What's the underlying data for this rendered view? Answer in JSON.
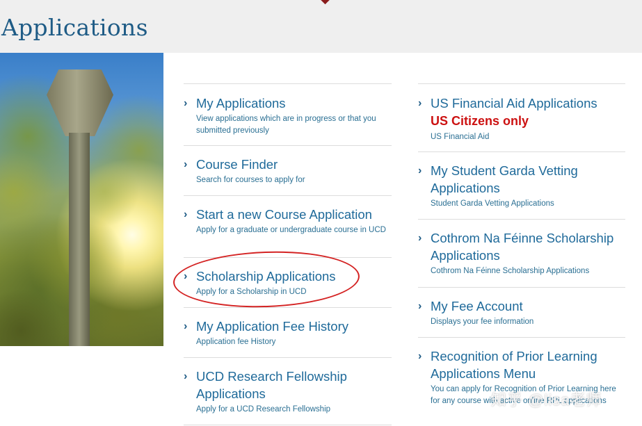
{
  "page": {
    "title": "Applications"
  },
  "left_column": [
    {
      "title": "My Applications",
      "desc": "View applications which are in progress or that you submitted previously"
    },
    {
      "title": "Course Finder",
      "desc": "Search for courses to apply for"
    },
    {
      "title": "Start a new Course Application",
      "desc": "Apply for a graduate or undergraduate course in UCD"
    },
    {
      "title": "Scholarship Applications",
      "desc": "Apply for a Scholarship in UCD"
    },
    {
      "title": "My Application Fee History",
      "desc": "Application fee History"
    },
    {
      "title": "UCD Research Fellowship Applications",
      "desc": "Apply for a UCD Research Fellowship"
    }
  ],
  "right_column": [
    {
      "title": "US Financial Aid Applications",
      "note": "US Citizens only",
      "desc": "US Financial Aid"
    },
    {
      "title": "My Student Garda Vetting Applications",
      "desc": "Student Garda Vetting Applications"
    },
    {
      "title": "Cothrom Na Féinne Scholarship Applications",
      "desc": "Cothrom Na Féinne Scholarship Applications"
    },
    {
      "title": "My Fee Account",
      "desc": "Displays your fee information"
    },
    {
      "title": "Recognition of Prior Learning Applications Menu",
      "desc": "You can apply for Recognition of Prior Learning here for any course with active online RPL applications"
    }
  ],
  "watermark": {
    "text": "知乎 @lisa老师"
  },
  "colors": {
    "link": "#1f6a9a",
    "warning": "#cc1111",
    "annotation": "#d42323",
    "header_bg": "#efefef"
  },
  "icons": {
    "chevron": "chevron-right-icon"
  }
}
